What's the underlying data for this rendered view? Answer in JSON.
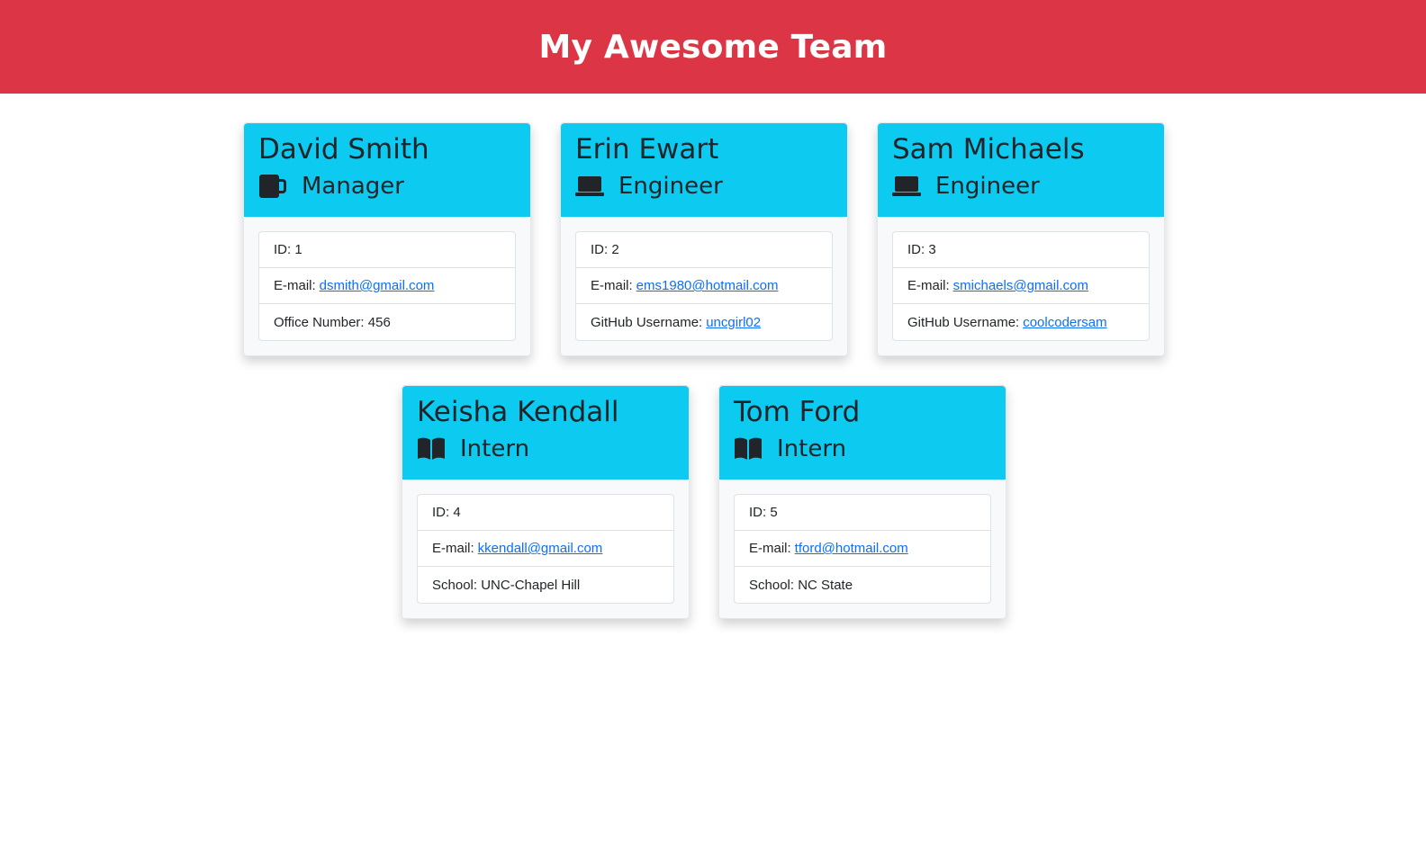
{
  "header": {
    "title": "My Awesome Team"
  },
  "colors": {
    "header_bg": "#dc3545",
    "card_header_bg": "#0dcaf0",
    "link": "#0d6efd"
  },
  "team": [
    {
      "name": "David Smith",
      "role": "Manager",
      "icon": "mug-icon",
      "id_text": "ID: 1",
      "email_label": "E-mail:",
      "email": "dsmith@gmail.com",
      "extra_label": "Office Number: 456",
      "extra_link": ""
    },
    {
      "name": "Erin Ewart",
      "role": "Engineer",
      "icon": "laptop-icon",
      "id_text": "ID: 2",
      "email_label": "E-mail:",
      "email": "ems1980@hotmail.com",
      "extra_label": "GitHub Username:",
      "extra_link": "uncgirl02"
    },
    {
      "name": "Sam Michaels",
      "role": "Engineer",
      "icon": "laptop-icon",
      "id_text": "ID: 3",
      "email_label": "E-mail:",
      "email": "smichaels@gmail.com",
      "extra_label": "GitHub Username:",
      "extra_link": "coolcodersam"
    },
    {
      "name": "Keisha Kendall",
      "role": "Intern",
      "icon": "book-icon",
      "id_text": "ID: 4",
      "email_label": "E-mail:",
      "email": "kkendall@gmail.com",
      "extra_label": "School: UNC-Chapel Hill",
      "extra_link": ""
    },
    {
      "name": "Tom Ford",
      "role": "Intern",
      "icon": "book-icon",
      "id_text": "ID: 5",
      "email_label": "E-mail:",
      "email": "tford@hotmail.com",
      "extra_label": "School: NC State",
      "extra_link": ""
    }
  ]
}
